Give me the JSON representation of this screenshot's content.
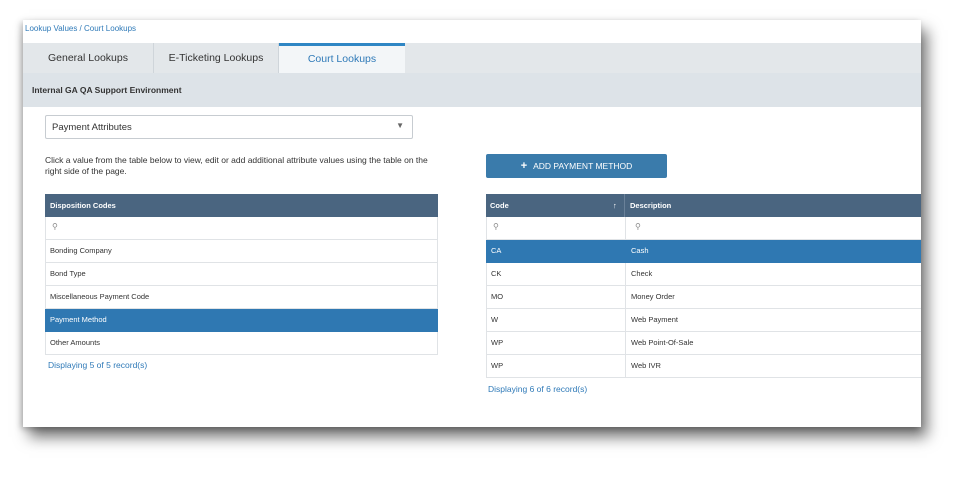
{
  "breadcrumb": "Lookup Values / Court Lookups",
  "tabs": [
    {
      "label": "General Lookups"
    },
    {
      "label": "E-Ticketing Lookups"
    },
    {
      "label": "Court Lookups"
    }
  ],
  "environment": "Internal GA QA Support Environment",
  "attribute_select": {
    "value": "Payment Attributes"
  },
  "instructions": "Click a value from the table below to view, edit or add additional attribute values using the table on the right side of the page.",
  "add_button": {
    "label": "ADD PAYMENT METHOD"
  },
  "left_table": {
    "header": "Disposition Codes",
    "rows": [
      "Bonding Company",
      "Bond Type",
      "Miscellaneous Payment Code",
      "Payment Method",
      "Other Amounts"
    ],
    "selected": "Payment Method",
    "footer": "Displaying 5 of 5 record(s)"
  },
  "right_table": {
    "headers": [
      "Code",
      "Description"
    ],
    "sort_indicator": "↑",
    "rows": [
      {
        "code": "CA",
        "description": "Cash"
      },
      {
        "code": "CK",
        "description": "Check"
      },
      {
        "code": "MO",
        "description": "Money Order"
      },
      {
        "code": "W",
        "description": "Web Payment"
      },
      {
        "code": "WP",
        "description": "Web Point-Of-Sale"
      },
      {
        "code": "WP",
        "description": "Web IVR"
      }
    ],
    "selected": "CA",
    "footer": "Displaying 6 of 6 record(s)"
  },
  "icons": {
    "search": "search-icon",
    "dropdown": "chevron-down-icon",
    "add": "plus-icon",
    "sort": "sort-asc-icon"
  }
}
